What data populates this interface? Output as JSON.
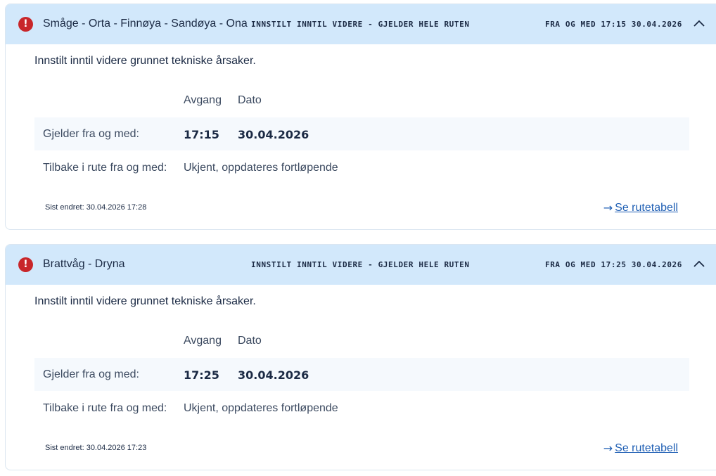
{
  "notices": [
    {
      "route": "Småge - Orta - Finnøya - Sandøya - Ona",
      "status": "INNSTILT INNTIL VIDERE - GJELDER HELE RUTEN",
      "from": "FRA OG MED 17:15 30.04.2026",
      "description": "Innstilt inntil videre grunnet tekniske årsaker.",
      "col_departure": "Avgang",
      "col_date": "Dato",
      "valid_from_label": "Gjelder fra og med:",
      "valid_from_departure": "17:15",
      "valid_from_date": "30.04.2026",
      "return_label": "Tilbake i rute fra og med:",
      "return_value": "Ukjent, oppdateres fortløpende",
      "last_changed": "Sist endret: 30.04.2026 17:28",
      "timetable_link": "Se rutetabell"
    },
    {
      "route": "Brattvåg - Dryna",
      "status": "INNSTILT INNTIL VIDERE - GJELDER HELE RUTEN",
      "from": "FRA OG MED 17:25 30.04.2026",
      "description": "Innstilt inntil videre grunnet tekniske årsaker.",
      "col_departure": "Avgang",
      "col_date": "Dato",
      "valid_from_label": "Gjelder fra og med:",
      "valid_from_departure": "17:25",
      "valid_from_date": "30.04.2026",
      "return_label": "Tilbake i rute fra og med:",
      "return_value": "Ukjent, oppdateres fortløpende",
      "last_changed": "Sist endret: 30.04.2026 17:23",
      "timetable_link": "Se rutetabell"
    }
  ],
  "icons": {
    "alert": "exclamation-circle-icon",
    "collapse": "chevron-up-icon",
    "link_arrow": "arrow-right-icon"
  },
  "colors": {
    "header_bg": "#d2e8fb",
    "alert_red": "#c8262a",
    "link_blue": "#1f5fb4",
    "text_dark": "#1b2a44"
  }
}
